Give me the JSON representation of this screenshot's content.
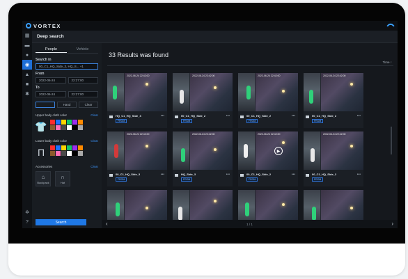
{
  "app": {
    "brand": "VORTEX"
  },
  "header": {
    "title": "Deep search"
  },
  "panel": {
    "tabs": [
      "People",
      "Vehicle"
    ],
    "search_in_label": "Search in",
    "search_in_value": "00_C1_HQ_Side_3, HQ_S... +1",
    "from_label": "From",
    "from_date": "2022-06-24",
    "from_time": "22:27:00",
    "to_label": "To",
    "to_date": "2022-06-24",
    "to_time": "22:27:00",
    "mini_tabs": [
      "",
      "Hand",
      "Clear"
    ],
    "upper_label": "Upper body cloth color",
    "lower_label": "Lower body cloth color",
    "clear_label": "Clear",
    "accessories_label": "Accessories",
    "accessories": [
      "Backpack",
      "Hat"
    ],
    "search_button": "Search"
  },
  "colors": {
    "upper": [
      "#ff2d2d",
      "#1e6fff",
      "#ffd500",
      "#13c56b",
      "#9b2df0",
      "#ff8a00",
      "#8b5a2b",
      "#ff6fb7",
      "#4a4a4a",
      "#ffffff",
      "#000000",
      "#aaaaaa"
    ],
    "lower": [
      "#ff2d2d",
      "#1e6fff",
      "#ffd500",
      "#13c56b",
      "#9b2df0",
      "#ff8a00",
      "#8b5a2b",
      "#ff6fb7",
      "#4a4a4a",
      "#ffffff",
      "#000000",
      "#aaaaaa"
    ]
  },
  "main": {
    "results_title": "33 Results was found",
    "sort_label": "Time ↑",
    "pagination": "1 / 1"
  },
  "cards": [
    {
      "name": "HQ_C1_HQ_Side_3",
      "badge": "FROM",
      "ts": "2022-06-24 22:42:00"
    },
    {
      "name": "00_C1_HQ_Side_2",
      "badge": "FROM",
      "ts": "2022-06-24 22:42:00"
    },
    {
      "name": "00_C1_HQ_Side_2",
      "badge": "FROM",
      "ts": "2022-06-24 22:42:00"
    },
    {
      "name": "00_C1_HQ_Side_2",
      "badge": "FROM",
      "ts": "2022-06-24 22:42:00"
    },
    {
      "name": "00_C1_HQ_Side_3",
      "badge": "FROM",
      "ts": "2022-06-24 22:42:00"
    },
    {
      "name": "HQ_Side_3",
      "badge": "FROM",
      "ts": "2022-06-24 22:42:00"
    },
    {
      "name": "00_C1_HQ_Side_2",
      "badge": "FROM",
      "ts": "2022-06-24 22:42:00"
    },
    {
      "name": "00_C1_HQ_Side_2",
      "badge": "FROM",
      "ts": "2022-06-24 22:42:00"
    },
    {
      "name": "",
      "badge": "",
      "ts": ""
    },
    {
      "name": "",
      "badge": "",
      "ts": ""
    },
    {
      "name": "",
      "badge": "",
      "ts": ""
    },
    {
      "name": "",
      "badge": "",
      "ts": ""
    }
  ]
}
